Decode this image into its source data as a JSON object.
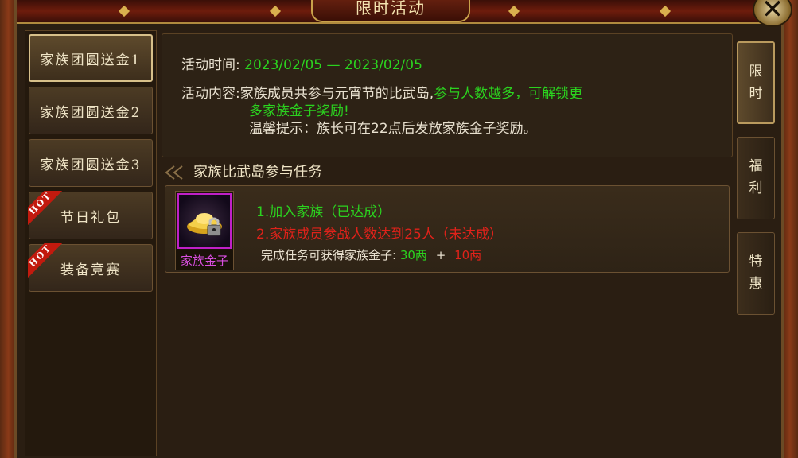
{
  "window": {
    "title": "限时活动",
    "close_label": "✕"
  },
  "sidebar": {
    "items": [
      {
        "label": "家族团圆送金1",
        "active": true,
        "hot": false
      },
      {
        "label": "家族团圆送金2",
        "active": false,
        "hot": false
      },
      {
        "label": "家族团圆送金3",
        "active": false,
        "hot": false
      },
      {
        "label": "节日礼包",
        "active": false,
        "hot": true
      },
      {
        "label": "装备竞赛",
        "active": false,
        "hot": true
      }
    ],
    "hot_badge": "HOT"
  },
  "activity": {
    "time_label": "活动时间:",
    "time_value": "2023/02/05 — 2023/02/05",
    "content_label": "活动内容:",
    "content_plain": "家族成员共参与元宵节的比武岛,",
    "content_green_1": "参与人数越多，可解锁更",
    "content_green_2": "多家族金子奖励!",
    "tip": "温馨提示：族长可在22点后发放家族金子奖励。"
  },
  "task": {
    "section_title": "家族比武岛参与任务",
    "item_name": "家族金子",
    "item_icon": "gold-ingot-lock-icon",
    "goal_1": "1.加入家族（已达成）",
    "goal_2": "2.家族成员参战人数达到25人（未达成）",
    "reward_label": "完成任务可获得家族金子:",
    "reward_base": "30两",
    "reward_plus": "+",
    "reward_extra": "10两"
  },
  "tabs": [
    {
      "label": "限时",
      "active": true
    },
    {
      "label": "福利",
      "active": false
    },
    {
      "label": "特惠",
      "active": false
    }
  ],
  "colors": {
    "green": "#2bd21f",
    "red": "#e0221a",
    "purple": "#c020c8",
    "gold": "#c9a24a"
  }
}
